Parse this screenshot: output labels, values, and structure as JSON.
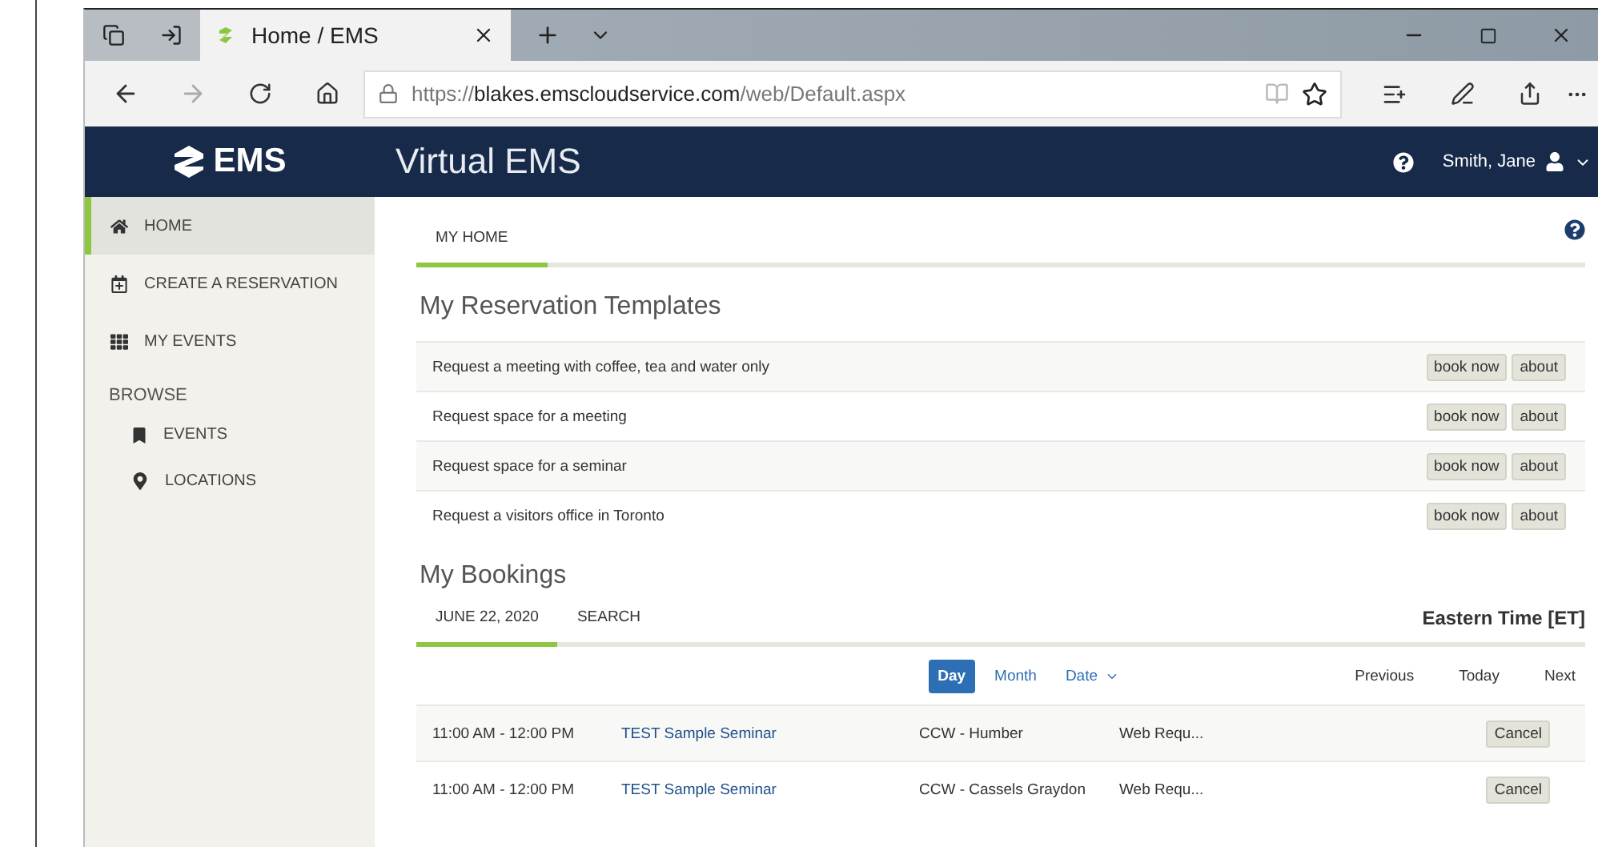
{
  "browser": {
    "tabs": [
      {
        "title": "Home / EMS",
        "selected": true
      }
    ],
    "address": {
      "scheme": "https://",
      "host": "blakes.emscloudservice.com",
      "path": "/web/Default.aspx"
    }
  },
  "header": {
    "logo_text": "EMS",
    "title": "Virtual EMS",
    "user": "Smith, Jane"
  },
  "sidebar": {
    "items": [
      {
        "kind": "link",
        "label": "HOME",
        "selected": true
      },
      {
        "kind": "link",
        "label": "CREATE A RESERVATION",
        "selected": false
      },
      {
        "kind": "link",
        "label": "MY EVENTS",
        "selected": false
      },
      {
        "kind": "heading",
        "label": "BROWSE",
        "children": [
          {
            "kind": "link",
            "label": "EVENTS",
            "selected": false
          },
          {
            "kind": "link",
            "label": "LOCATIONS",
            "selected": false
          }
        ]
      }
    ]
  },
  "content": {
    "tabs": [
      {
        "label": "MY HOME",
        "selected": true
      }
    ],
    "templates": {
      "title": "My Reservation Templates",
      "rows": [
        {
          "text": "Request a meeting with coffee, tea and water only",
          "book": "book now",
          "about": "about"
        },
        {
          "text": "Request space for a meeting",
          "book": "book now",
          "about": "about"
        },
        {
          "text": "Request space for a seminar",
          "book": "book now",
          "about": "about"
        },
        {
          "text": "Request a visitors office in Toronto",
          "book": "book now",
          "about": "about"
        }
      ]
    },
    "bookings": {
      "title": "My Bookings",
      "tabs": [
        {
          "label": "JUNE 22, 2020",
          "selected": true
        },
        {
          "label": "SEARCH",
          "selected": false
        }
      ],
      "timezone": "Eastern Time [ET]",
      "views": [
        {
          "label": "Day",
          "selected": true,
          "kind": "button"
        },
        {
          "label": "Month",
          "selected": false,
          "kind": "button"
        },
        {
          "label": "Date",
          "selected": false,
          "kind": "dropdown"
        }
      ],
      "nav": [
        "Previous",
        "Today",
        "Next"
      ],
      "rows": [
        {
          "time": "11:00 AM - 12:00 PM",
          "event": "TEST Sample Seminar",
          "location": "CCW - Humber",
          "status": "Web Requ...",
          "action": "Cancel"
        },
        {
          "time": "11:00 AM - 12:00 PM",
          "event": "TEST Sample Seminar",
          "location": "CCW - Cassels Graydon",
          "status": "Web Requ...",
          "action": "Cancel"
        }
      ]
    }
  }
}
